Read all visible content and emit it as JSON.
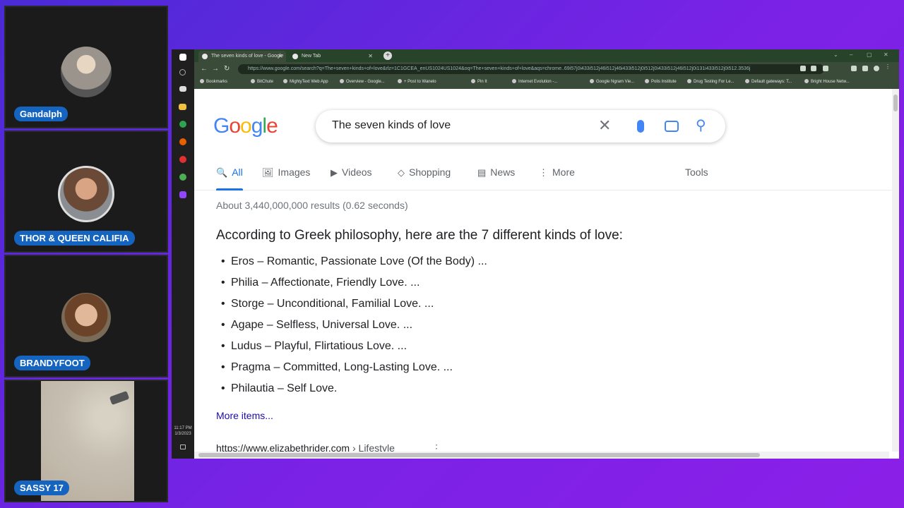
{
  "participants": [
    {
      "name": "Gandalph"
    },
    {
      "name": "THOR & QUEEN CALIFIA"
    },
    {
      "name": "BRANDYFOOT"
    },
    {
      "name": "SASSY 17"
    }
  ],
  "taskbar": {
    "time": "11:17 PM",
    "date": "1/3/2023"
  },
  "browser": {
    "tabs": [
      {
        "title": "The seven kinds of love - Google",
        "active": true
      },
      {
        "title": "New Tab",
        "active": false
      }
    ],
    "url": "https://www.google.com/search?q=The+seven+kinds+of+love&rlz=1C1GCEA_enUS1024US1024&oq=The+seven+kinds+of+love&aqs=chrome..69i57j0i433i512j46i512j46i433i512j0i512j0i433i512j46i512j0i131i433i512j0i512.3536j",
    "bookmarks": [
      "Bookmarks",
      "BitChute",
      "MightyText Web App",
      "Overview - Google...",
      "+ Post to Wanelo",
      "Pin It",
      "Internet Evolution -...",
      "Google Ngram Vie...",
      "Polis Institute",
      "Drug Testing For Le...",
      "Default gateways: T...",
      "Bright House Netw..."
    ]
  },
  "google": {
    "logo": [
      "G",
      "o",
      "o",
      "g",
      "l",
      "e"
    ],
    "query": "The seven kinds of love",
    "tabs": [
      {
        "label": "All",
        "icon": "🔍"
      },
      {
        "label": "Images",
        "icon": "🖼"
      },
      {
        "label": "Videos",
        "icon": "▶"
      },
      {
        "label": "Shopping",
        "icon": "◇"
      },
      {
        "label": "News",
        "icon": "▤"
      },
      {
        "label": "More",
        "icon": "⋮"
      }
    ],
    "tools": "Tools",
    "stats": "About 3,440,000,000 results (0.62 seconds)",
    "heading": "According to Greek philosophy, here are the 7 different kinds of love:",
    "items": [
      "Eros – Romantic, Passionate Love (Of the Body) ...",
      "Philia – Affectionate, Friendly Love. ...",
      "Storge – Unconditional, Familial Love. ...",
      "Agape – Selfless, Universal Love. ...",
      "Ludus – Playful, Flirtatious Love. ...",
      "Pragma – Committed, Long-Lasting Love. ...",
      "Philautia – Self Love."
    ],
    "more_items": "More items...",
    "cite_url": "https://www.elizabethrider.com",
    "cite_crumb": "› Lifestyle"
  },
  "colors": {
    "accent": "#1a73e8",
    "name_tag": "#1565c0",
    "link": "#1a0dab"
  }
}
